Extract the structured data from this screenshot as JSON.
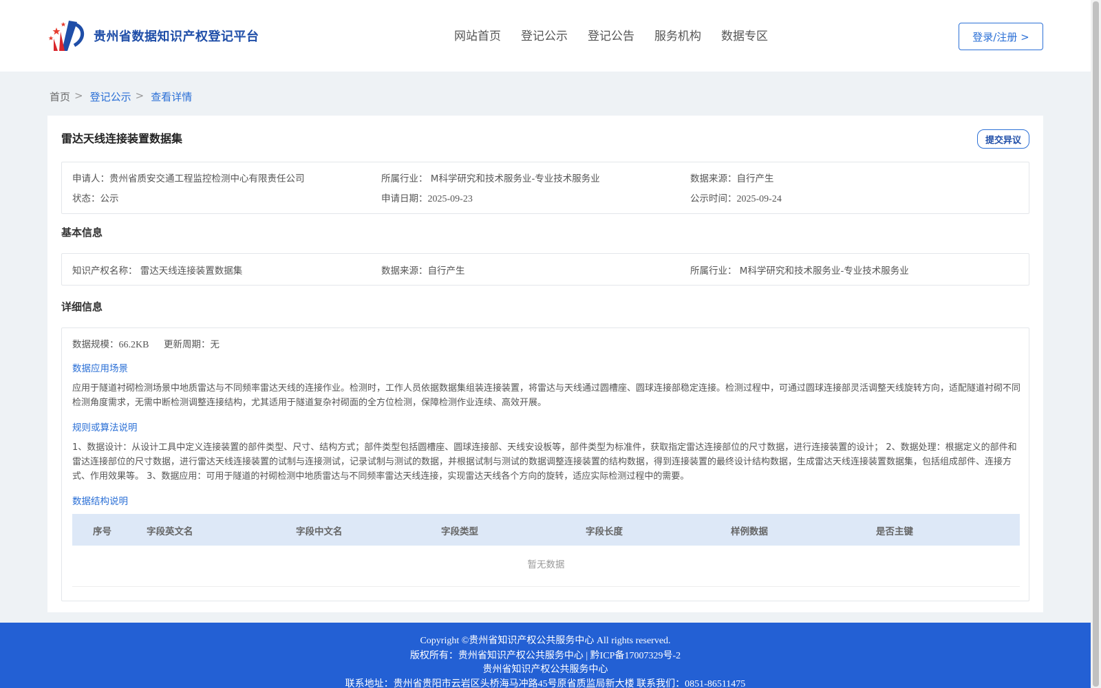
{
  "header": {
    "logo_title": "贵州省数据知识产权登记平台",
    "nav": [
      "网站首页",
      "登记公示",
      "登记公告",
      "服务机构",
      "数据专区"
    ],
    "login_label": "登录/注册 >",
    "brand_color": "#1f4ea8",
    "accent_color": "#2a6fd6"
  },
  "breadcrumb": {
    "home": "首页",
    "sep": ">",
    "level1": "登记公示",
    "level2": "查看详情"
  },
  "record": {
    "title": "雷达天线连接装置数据集",
    "objection_label": "提交异议",
    "applicant": "申请人：贵州省质安交通工程监控检测中心有限责任公司",
    "industry": "所属行业：  M科学研究和技术服务业-专业技术服务业",
    "source": "数据来源：自行产生",
    "status": "状态：公示",
    "apply_date_label": "申请日期：",
    "apply_date": "2025-09-23",
    "publish_date_label": "公示时间：",
    "publish_date": "2025-09-24"
  },
  "basic": {
    "section_title": "基本信息",
    "ip_name": "知识产权名称：  雷达天线连接装置数据集",
    "source": "数据来源：自行产生",
    "industry": "所属行业：  M科学研究和技术服务业-专业技术服务业"
  },
  "detail": {
    "section_title": "详细信息",
    "scale_label": "数据规模：",
    "scale_value": "66.2KB",
    "update_cycle": "更新周期：无",
    "scene_title": "数据应用场景",
    "scene_text": "应用于隧道衬砌检测场景中地质雷达与不同频率雷达天线的连接作业。检测时，工作人员依据数据集组装连接装置，将雷达与天线通过圆槽座、圆球连接部稳定连接。检测过程中，可通过圆球连接部灵活调整天线旋转方向，适配隧道衬砌不同检测角度需求，无需中断检测调整连接结构，尤其适用于隧道复杂衬砌面的全方位检测，保障检测作业连续、高效开展。",
    "rule_title": "规则或算法说明",
    "rule_text": "1、数据设计：从设计工具中定义连接装置的部件类型、尺寸、结构方式；部件类型包括圆槽座、圆球连接部、天线安设板等，部件类型为标准件，获取指定雷达连接部位的尺寸数据，进行连接装置的设计；  2、数据处理：根据定义的部件和雷达连接部位的尺寸数据，进行雷达天线连接装置的试制与连接测试，记录试制与测试的数据，并根据试制与测试的数据调整连接装置的结构数据，得到连接装置的最终设计结构数据，生成雷达天线连接装置数据集，包括组成部件、连接方式、作用效果等。  3、数据应用：可用于隧道的衬砌检测中地质雷达与不同频率雷达天线连接，实现雷达天线各个方向的旋转，适应实际检测过程中的需要。",
    "structure_title": "数据结构说明",
    "table_headers": [
      "序号",
      "字段英文名",
      "字段中文名",
      "字段类型",
      "字段长度",
      "样例数据",
      "是否主键"
    ],
    "empty_text": "暂无数据"
  },
  "footer": {
    "copyright": "Copyright ©贵州省知识产权公共服务中心 All rights reserved.",
    "owner": "版权所有：贵州省知识产权公共服务中心 | 黔ICP备17007329号-2",
    "org": "贵州省知识产权公共服务中心",
    "contact": "联系地址：贵州省贵阳市云岩区头桥海马冲路45号原省质监局新大楼 联系我们：0851-86511475",
    "bg_color": "#2360d4"
  }
}
